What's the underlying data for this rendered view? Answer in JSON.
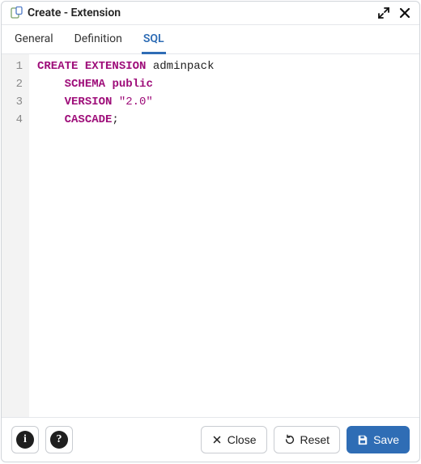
{
  "dialog": {
    "title": "Create - Extension"
  },
  "tabs": [
    {
      "id": "general",
      "label": "General",
      "active": false
    },
    {
      "id": "definition",
      "label": "Definition",
      "active": false
    },
    {
      "id": "sql",
      "label": "SQL",
      "active": true
    }
  ],
  "editor": {
    "lines": [
      {
        "num": "1",
        "tokens": [
          {
            "t": "CREATE",
            "c": "kw"
          },
          {
            "t": " ",
            "c": "sp"
          },
          {
            "t": "EXTENSION",
            "c": "kw"
          },
          {
            "t": " ",
            "c": "sp"
          },
          {
            "t": "adminpack",
            "c": "id"
          }
        ]
      },
      {
        "num": "2",
        "tokens": [
          {
            "t": "    ",
            "c": "sp"
          },
          {
            "t": "SCHEMA",
            "c": "kw"
          },
          {
            "t": " ",
            "c": "sp"
          },
          {
            "t": "public",
            "c": "kw"
          }
        ]
      },
      {
        "num": "3",
        "tokens": [
          {
            "t": "    ",
            "c": "sp"
          },
          {
            "t": "VERSION",
            "c": "kw"
          },
          {
            "t": " ",
            "c": "sp"
          },
          {
            "t": "\"2.0\"",
            "c": "str"
          }
        ]
      },
      {
        "num": "4",
        "tokens": [
          {
            "t": "    ",
            "c": "sp"
          },
          {
            "t": "CASCADE",
            "c": "kw"
          },
          {
            "t": ";",
            "c": "punc"
          }
        ]
      }
    ]
  },
  "footer": {
    "info_glyph": "i",
    "help_glyph": "?",
    "close_label": "Close",
    "reset_label": "Reset",
    "save_label": "Save"
  }
}
